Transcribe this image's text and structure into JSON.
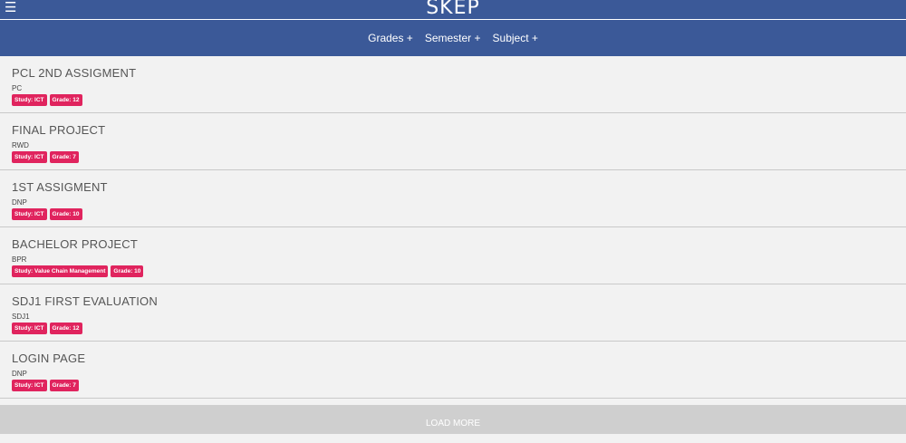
{
  "app": {
    "title": "SKEP",
    "menu_icon": "hamburger-menu-icon"
  },
  "nav": {
    "items": [
      "Grades +",
      "Semester +",
      "Subject +"
    ]
  },
  "assignments": [
    {
      "title": "PCL 2ND ASSIGMENT",
      "code": "PC",
      "tags": [
        "Study: ICT",
        "Grade: 12"
      ]
    },
    {
      "title": "FINAL PROJECT",
      "code": "RWD",
      "tags": [
        "Study: ICT",
        "Grade: 7"
      ]
    },
    {
      "title": "1ST ASSIGMENT",
      "code": "DNP",
      "tags": [
        "Study: ICT",
        "Grade: 10"
      ]
    },
    {
      "title": "BACHELOR PROJECT",
      "code": "BPR",
      "tags": [
        "Study: Value Chain Management",
        "Grade: 10"
      ]
    },
    {
      "title": "SDJ1 FIRST EVALUATION",
      "code": "SDJ1",
      "tags": [
        "Study: ICT",
        "Grade: 12"
      ]
    },
    {
      "title": "LOGIN PAGE",
      "code": "DNP",
      "tags": [
        "Study: ICT",
        "Grade: 7"
      ]
    }
  ],
  "load_more": "LOAD MORE",
  "colors": {
    "header": "#3b5998",
    "tag": "#e0245e",
    "load_more_bg": "#cfcfcf"
  }
}
